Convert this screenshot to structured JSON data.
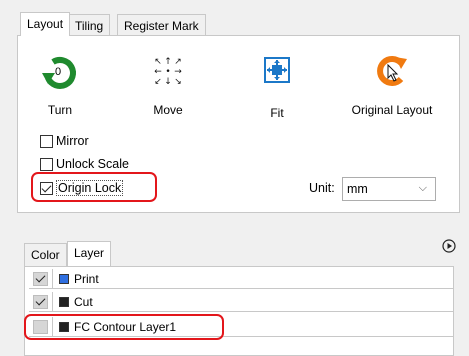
{
  "tabs": [
    "Layout",
    "Tiling",
    "Register Mark"
  ],
  "tools": {
    "turn_label": "Turn",
    "turn_value": "0",
    "move_label": "Move",
    "fit_label": "Fit",
    "original_layout_label": "Original Layout"
  },
  "options": {
    "mirror": "Mirror",
    "unlock_scale": "Unlock Scale",
    "origin_lock": "Origin Lock",
    "mirror_checked": false,
    "unlock_scale_checked": false,
    "origin_lock_checked": true
  },
  "unit": {
    "label": "Unit:",
    "value": "mm"
  },
  "bottom_tabs": [
    "Color",
    "Layer"
  ],
  "layers": [
    {
      "name": "Print",
      "visible": true,
      "color": "#2f6fe0"
    },
    {
      "name": "Cut",
      "visible": true,
      "color": "#222222"
    },
    {
      "name": "FC Contour Layer1",
      "visible": false,
      "color": "#222222"
    }
  ],
  "colors": {
    "highlight": "#e3161b",
    "turn_green": "#1f8a2e",
    "fit_blue": "#1c78c8",
    "orig_orange": "#f07a10"
  }
}
